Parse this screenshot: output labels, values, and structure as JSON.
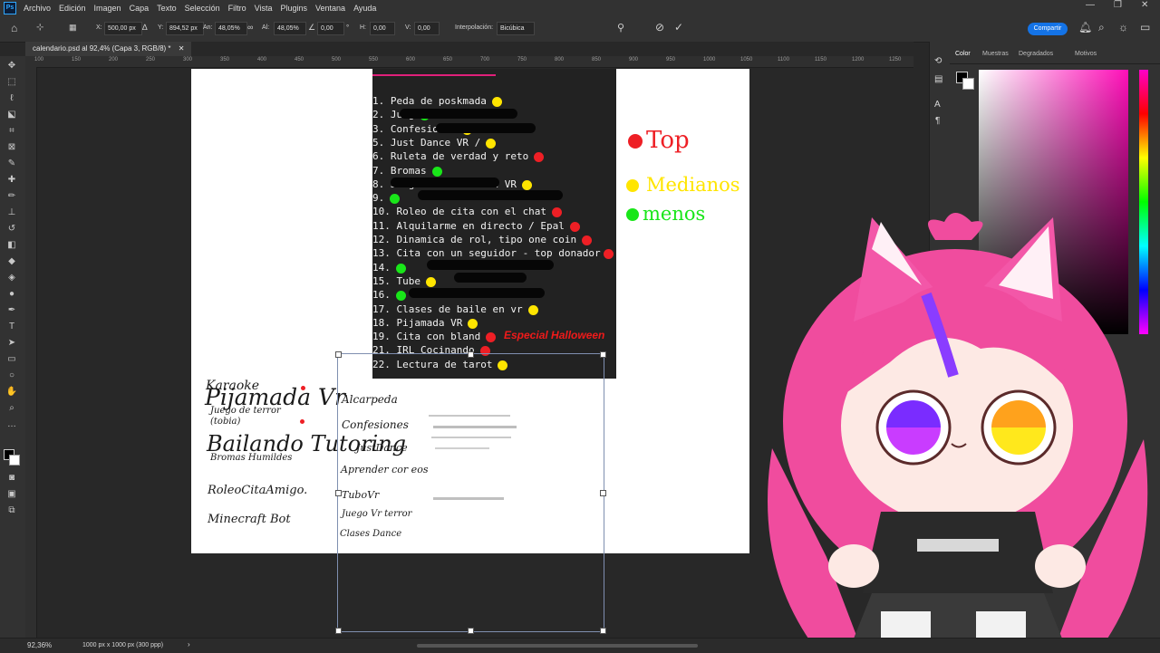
{
  "menu": {
    "items": [
      "Archivo",
      "Edición",
      "Imagen",
      "Capa",
      "Texto",
      "Selección",
      "Filtro",
      "Vista",
      "Plugins",
      "Ventana",
      "Ayuda"
    ]
  },
  "options": {
    "x_label": "X:",
    "x_value": "500,00 px",
    "y_label": "Y:",
    "y_value": "894,52 px",
    "w_label": "An:",
    "w_value": "48,05%",
    "h_label": "Al:",
    "h_value": "48,05%",
    "angle_value": "0,00",
    "hs_label": "H:",
    "hs_value": "0,00",
    "vs_label": "V:",
    "vs_value": "0,00",
    "interp_label": "Interpolación:",
    "interp_value": "Bicúbica",
    "share_label": "Compartir"
  },
  "document": {
    "tab_title": "calendario.psd al 92,4% (Capa 3, RGB/8) *"
  },
  "ruler": {
    "ticks": [
      "100",
      "150",
      "200",
      "250",
      "300",
      "350",
      "400",
      "450",
      "500",
      "550",
      "600",
      "650",
      "700",
      "750",
      "800",
      "850",
      "900",
      "950",
      "1000",
      "1050",
      "1100",
      "1150",
      "1200",
      "1250"
    ]
  },
  "list": {
    "items": [
      {
        "text": "1. Peda de poskmada",
        "dot": "yellow"
      },
      {
        "text": "2. Jueg",
        "dot": "green"
      },
      {
        "text": "3. Confesiones",
        "dot": "yellow"
      },
      {
        "text": "5. Just Dance VR /",
        "dot": "yellow"
      },
      {
        "text": "6. Ruleta de verdad y reto",
        "dot": "red"
      },
      {
        "text": "7. Bromas",
        "dot": "green"
      },
      {
        "text": "8. Juego de terror en VR",
        "dot": "yellow"
      },
      {
        "text": "9.",
        "dot": "green"
      },
      {
        "text": "10. Roleo de cita con el chat",
        "dot": "red"
      },
      {
        "text": "11. Alquilarme en directo / Epal",
        "dot": "red"
      },
      {
        "text": "12. Dinamica de rol, tipo one coin",
        "dot": "red"
      },
      {
        "text": "13. Cita con un seguidor - top donador",
        "dot": "red"
      },
      {
        "text": "14.",
        "dot": "green"
      },
      {
        "text": "15. Tube",
        "dot": "yellow"
      },
      {
        "text": "16.",
        "dot": "green"
      },
      {
        "text": "17. Clases de baile en vr",
        "dot": "yellow"
      },
      {
        "text": "18. Pijamada VR",
        "dot": "yellow"
      },
      {
        "text": "19. Cita con bland",
        "dot": "red"
      },
      {
        "text": "21. IRL Cocinando",
        "dot": "red"
      },
      {
        "text": "22. Lectura de tarot",
        "dot": "yellow"
      }
    ],
    "special": "Especial Halloween"
  },
  "legend": {
    "top": "Top",
    "mid": "Medianos",
    "low": "menos"
  },
  "notes_left": [
    "Karaoke",
    "Pijamada Vr",
    "Juego de terror (tobia)",
    "Bailando Tutoring",
    "Bromas Humildes",
    "RoleoCitaAmigo.",
    "Minecraft Bot"
  ],
  "notes_right": [
    "Alcarpeda",
    "Confesiones",
    "JustDance",
    "Aprender cor eos",
    "TuboVr",
    "Juego Vr terror",
    "Clases Dance"
  ],
  "panel": {
    "tabs": [
      "Color",
      "Muestras",
      "Degradados",
      "Motivos"
    ],
    "accent": "#ff0fb8"
  },
  "status": {
    "zoom": "92,36%",
    "doc_size": "1000 px x 1000 px (300 ppp)"
  }
}
